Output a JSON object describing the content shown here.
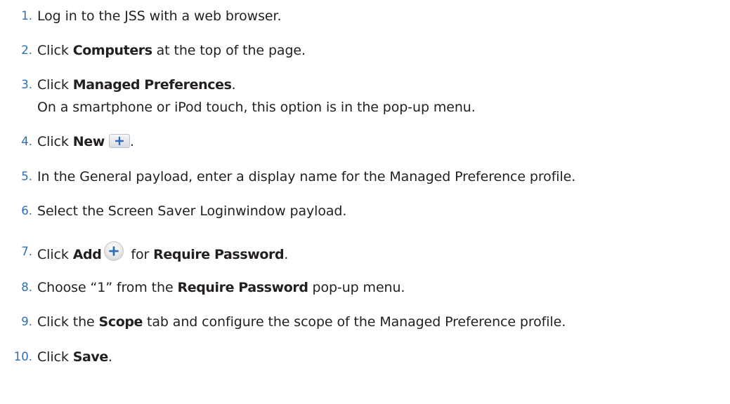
{
  "steps": [
    {
      "num": "1.",
      "text": "Log in to the JSS with a web browser."
    },
    {
      "num": "2.",
      "pre": "Click ",
      "bold": "Computers",
      "post": " at the top of the page."
    },
    {
      "num": "3.",
      "pre": "Click ",
      "bold": "Managed Preferences",
      "post": ".",
      "sub": "On a smartphone or iPod touch, this option is in the pop-up menu."
    },
    {
      "num": "4.",
      "pre": "Click ",
      "bold": "New",
      "post": "."
    },
    {
      "num": "5.",
      "text": "In the General payload, enter a display name for the Managed Preference profile."
    },
    {
      "num": "6.",
      "text": "Select the Screen Saver Loginwindow payload."
    },
    {
      "num": "7.",
      "pre": "Click ",
      "bold": "Add",
      "mid": " for ",
      "bold2": "Require Password",
      "post": "."
    },
    {
      "num": "8.",
      "pre": "Choose “1” from the ",
      "bold": "Require Password",
      "post": " pop-up menu."
    },
    {
      "num": "9.",
      "pre": "Click the ",
      "bold": "Scope",
      "post": " tab and configure the scope of the Managed Preference profile."
    },
    {
      "num": "10.",
      "pre": "Click ",
      "bold": "Save",
      "post": "."
    }
  ],
  "icons": {
    "new_button": "plus-icon",
    "add_button": "plus-circle-icon",
    "accent": "#2f6db5"
  }
}
